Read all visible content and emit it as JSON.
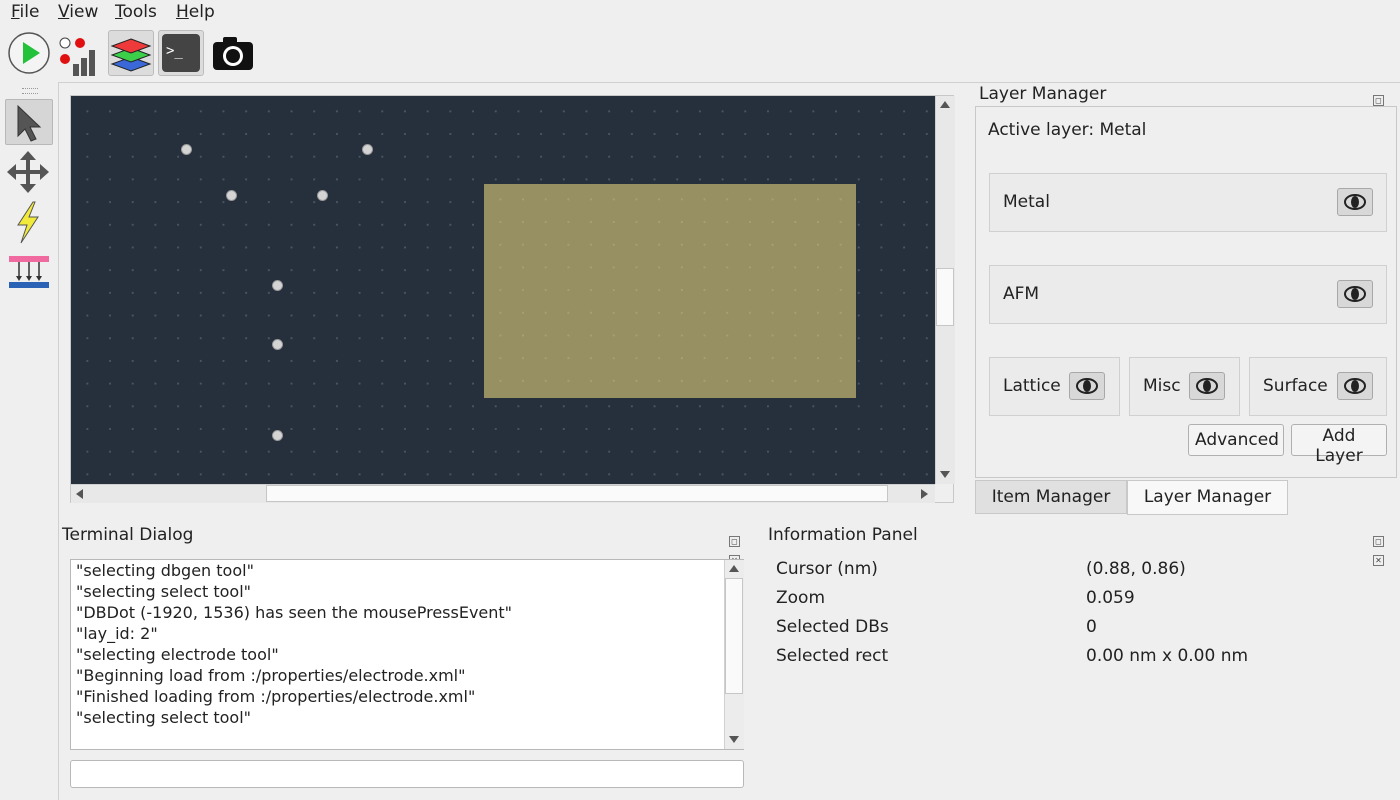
{
  "menu": {
    "items": [
      {
        "label": "File",
        "accel": "F",
        "rest": "ile"
      },
      {
        "label": "View",
        "accel": "V",
        "rest": "iew"
      },
      {
        "label": "Tools",
        "accel": "T",
        "rest": "ools"
      },
      {
        "label": "Help",
        "accel": "H",
        "rest": "elp"
      }
    ]
  },
  "toolbar": {
    "buttons": [
      "run-simulation",
      "simulation-visualize",
      "layer-manager-toggle",
      "terminal-toggle",
      "screenshot"
    ],
    "terminal_glyph": ">_"
  },
  "tools": [
    "select-tool",
    "drag-tool",
    "electrode-tool",
    "dbgen-tool"
  ],
  "layer_manager": {
    "title": "Layer Manager",
    "active_layer_text": "Active layer: Metal",
    "layers": [
      {
        "name": "Metal"
      },
      {
        "name": "AFM"
      },
      {
        "name": "Lattice"
      },
      {
        "name": "Misc"
      },
      {
        "name": "Surface"
      }
    ],
    "advanced_label": "Advanced",
    "add_layer_label": "Add Layer",
    "tabs": [
      {
        "label": "Item Manager",
        "active": false
      },
      {
        "label": "Layer Manager",
        "active": true
      }
    ]
  },
  "terminal": {
    "title": "Terminal Dialog",
    "lines": [
      "\"selecting dbgen tool\"",
      "\"selecting select tool\"",
      "\"DBDot (-1920, 1536) has seen the mousePressEvent\"",
      "\"lay_id: 2\"",
      "\"selecting electrode tool\"",
      "\"Beginning load from :/properties/electrode.xml\"",
      "\"Finished loading from :/properties/electrode.xml\"",
      "\"selecting select tool\""
    ],
    "input_value": ""
  },
  "info_panel": {
    "title": "Information Panel",
    "rows": [
      {
        "label": "Cursor (nm)",
        "value": "(0.88, 0.86)"
      },
      {
        "label": "Zoom",
        "value": "0.059"
      },
      {
        "label": "Selected DBs",
        "value": "0"
      },
      {
        "label": "Selected rect",
        "value": "0.00 nm x 0.00 nm"
      }
    ]
  },
  "colors": {
    "canvas_bg": "#262f3c",
    "electrode": "#9a9464",
    "db_dot": "#d4d4d4"
  }
}
